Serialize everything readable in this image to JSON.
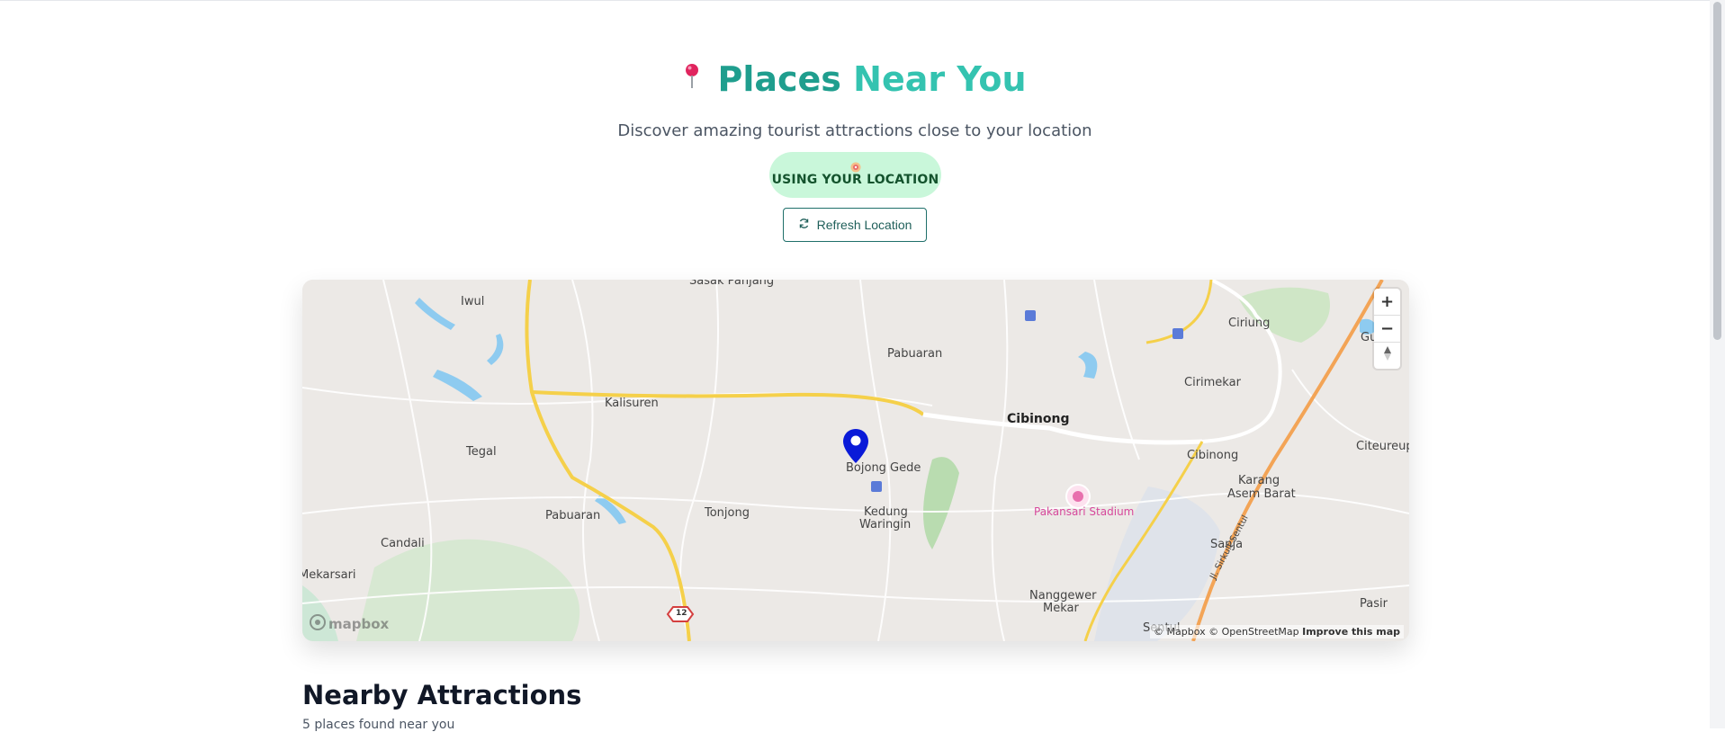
{
  "header": {
    "title_part1": "Places",
    "title_part2": "Near You",
    "subtitle": "Discover amazing tourist attractions close to your location"
  },
  "location": {
    "badge_label": "USING YOUR LOCATION",
    "refresh_label": "Refresh Location"
  },
  "map": {
    "labels": {
      "sasak_panjang": "Sasak Panjang",
      "iwul": "Iwul",
      "pabuaran_n": "Pabuaran",
      "kalisuren": "Kalisuren",
      "cibinong_c": "Cibinong",
      "ciriung": "Ciriung",
      "gunung": "Gunu",
      "cirimekar": "Cirimekar",
      "tegal": "Tegal",
      "bojong_gede": "Bojong Gede",
      "cibinong_e": "Cibinong",
      "citeureup": "Citeureup",
      "karang": "Karang",
      "asem_barat": "Asem Barat",
      "pakansari": "Pakansari Stadium",
      "pabuaran_w": "Pabuaran",
      "tonjong": "Tonjong",
      "kedung": "Kedung",
      "waringin": "Waringin",
      "candali": "Candali",
      "sanja": "Sanja",
      "mekarsari": "Mekarsari",
      "nanggewer": "Nanggewer",
      "mekar": "Mekar",
      "pasir": "Pasir",
      "sentul": "Sentul",
      "sirkuit": "Jl. Sirkuit Sentul",
      "road12": "12"
    },
    "zoom_in": "+",
    "zoom_out": "−",
    "attribution_mapbox": "© Mapbox",
    "attribution_osm": "© OpenStreetMap",
    "attribution_improve": "Improve this map",
    "logo": "mapbox"
  },
  "nearby": {
    "title": "Nearby Attractions",
    "count_text": "5 places found near you"
  },
  "colors": {
    "title_dark": "#1f9e8e",
    "title_light": "#34c3b0",
    "badge_bg": "#c9f7da",
    "marker": "#0a1ad8"
  }
}
